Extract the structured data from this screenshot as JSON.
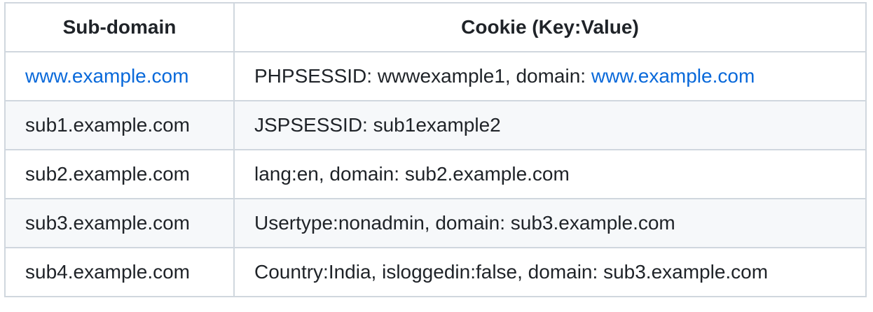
{
  "table": {
    "headers": [
      "Sub-domain",
      "Cookie (Key:Value)"
    ],
    "rows": [
      {
        "subdomain": "www.example.com",
        "cookie_prefix": "PHPSESSID: wwwexample1, domain: ",
        "cookie_link": "www.example.com"
      },
      {
        "subdomain": "sub1.example.com",
        "cookie": "JSPSESSID: sub1example2"
      },
      {
        "subdomain": "sub2.example.com",
        "cookie": "lang:en, domain: sub2.example.com"
      },
      {
        "subdomain": "sub3.example.com",
        "cookie": "Usertype:nonadmin, domain: sub3.example.com"
      },
      {
        "subdomain": "sub4.example.com",
        "cookie": "Country:India, isloggedin:false, domain: sub3.example.com"
      }
    ]
  },
  "colors": {
    "link": "#0969da",
    "border": "#d0d7de",
    "alt_row": "#f6f8fa",
    "text": "#1f2328"
  }
}
